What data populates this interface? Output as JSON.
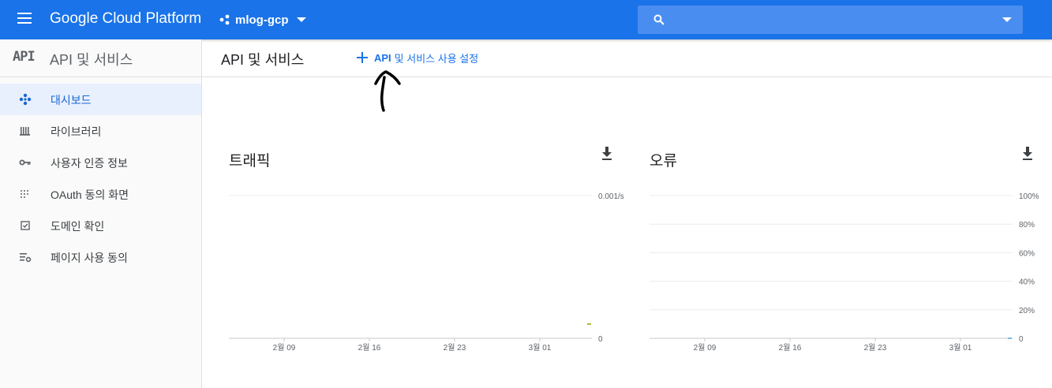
{
  "topbar": {
    "brand": "Google Cloud Platform",
    "project": "mlog-gcp",
    "search_placeholder": "",
    "color": "#1a73e8"
  },
  "sidebar": {
    "logo": "API",
    "title": "API 및 서비스",
    "items": [
      {
        "label": "대시보드",
        "icon": "dashboard-icon",
        "active": true
      },
      {
        "label": "라이브러리",
        "icon": "library-icon",
        "active": false
      },
      {
        "label": "사용자 인증 정보",
        "icon": "key-icon",
        "active": false
      },
      {
        "label": "OAuth 동의 화면",
        "icon": "consent-icon",
        "active": false
      },
      {
        "label": "도메인 확인",
        "icon": "check-box-icon",
        "active": false
      },
      {
        "label": "페이지 사용 동의",
        "icon": "settings-list-icon",
        "active": false
      }
    ]
  },
  "page": {
    "title": "API 및 서비스",
    "enable_button_strong": "API",
    "enable_button_rest": "및 서비스 사용 설정"
  },
  "chart_data": [
    {
      "type": "line",
      "title": "트래픽",
      "x_ticks": [
        "2월 09",
        "2월 16",
        "2월 23",
        "3월 01"
      ],
      "y_ticks": [
        "0.001/s",
        "0"
      ],
      "ylim": [
        0,
        0.001
      ],
      "series": [
        {
          "values": [
            0
          ]
        }
      ],
      "series_color": "#9aa000",
      "grid": true,
      "download_icon": "download-icon"
    },
    {
      "type": "line",
      "title": "오류",
      "x_ticks": [
        "2월 09",
        "2월 16",
        "2월 23",
        "3월 01"
      ],
      "y_ticks": [
        "100%",
        "80%",
        "60%",
        "40%",
        "20%",
        "0"
      ],
      "ylim": [
        0,
        100
      ],
      "series": [
        {
          "values": [
            0
          ]
        }
      ],
      "series_color": "#4ea6d8",
      "grid": true,
      "download_icon": "download-icon"
    }
  ]
}
